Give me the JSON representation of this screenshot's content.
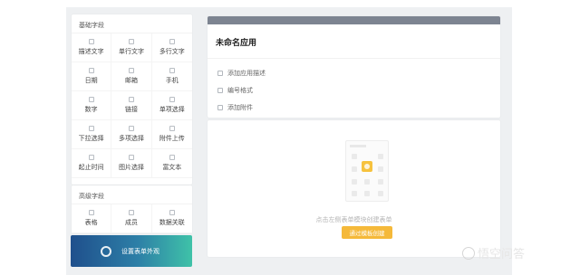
{
  "sections": {
    "basic": {
      "title": "基础字段",
      "items": [
        "描述文字",
        "单行文字",
        "多行文字",
        "日期",
        "邮箱",
        "手机",
        "数字",
        "链接",
        "单项选择",
        "下拉选择",
        "多项选择",
        "附件上传",
        "起止时间",
        "图片选择",
        "富文本"
      ]
    },
    "advanced": {
      "title": "高级字段",
      "items": [
        "表格",
        "成员",
        "数据关联"
      ]
    }
  },
  "banner": {
    "label": "设置表单外观"
  },
  "app": {
    "title": "未命名应用",
    "meta": [
      "添加应用描述",
      "编号格式",
      "添加附件"
    ]
  },
  "form": {
    "hint": "点击左侧表单模块创建表单",
    "cta": "通过模板创建"
  },
  "watermark": {
    "text": "悟空问答",
    "icon": "wukong-logo-icon"
  },
  "colors": {
    "accent": "#f5b93a",
    "topbar": "#7d8491"
  }
}
